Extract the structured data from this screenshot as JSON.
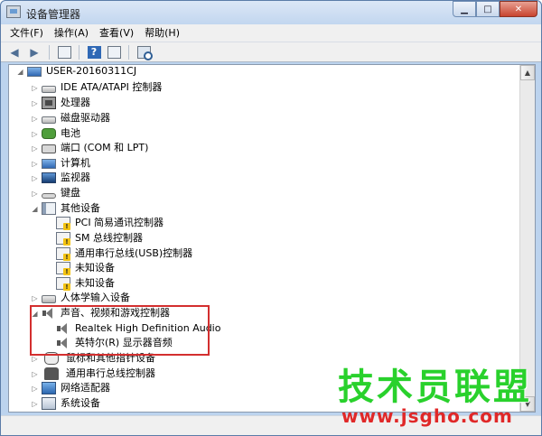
{
  "window": {
    "title": "设备管理器"
  },
  "window_buttons": {
    "minimize": "▁",
    "maximize": "□",
    "close": "✕"
  },
  "menu": {
    "items": [
      "文件(F)",
      "操作(A)",
      "查看(V)",
      "帮助(H)"
    ]
  },
  "toolbar": {
    "icons": [
      "back-arrow-icon",
      "forward-arrow-icon",
      "properties-icon",
      "help-icon",
      "console-tree-icon",
      "scan-hardware-icon"
    ]
  },
  "scrollbar": {
    "up": "▲",
    "down": "▼"
  },
  "tree": {
    "root": {
      "label": "USER-20160311CJ"
    },
    "expander_collapsed": "▷",
    "expander_expanded": "◢",
    "nodes": [
      {
        "label": "IDE ATA/ATAPI 控制器"
      },
      {
        "label": "处理器"
      },
      {
        "label": "磁盘驱动器"
      },
      {
        "label": "电池"
      },
      {
        "label": "端口 (COM 和 LPT)"
      },
      {
        "label": "计算机"
      },
      {
        "label": "监视器"
      },
      {
        "label": "键盘"
      },
      {
        "label": "其他设备"
      },
      {
        "label": "PCI 简易通讯控制器"
      },
      {
        "label": "SM 总线控制器"
      },
      {
        "label": "通用串行总线(USB)控制器"
      },
      {
        "label": "未知设备"
      },
      {
        "label": "未知设备"
      },
      {
        "label": "人体学输入设备"
      },
      {
        "label": "声音、视频和游戏控制器"
      },
      {
        "label": "Realtek High Definition Audio"
      },
      {
        "label": "英特尔(R) 显示器音频"
      },
      {
        "label": "鼠标和其他指针设备"
      },
      {
        "label": "通用串行总线控制器"
      },
      {
        "label": "网络适配器"
      },
      {
        "label": "系统设备"
      }
    ]
  },
  "watermark": {
    "title": "技术员联盟",
    "url": "www.jsgho.com"
  },
  "colors": {
    "highlight": "#d32f2f",
    "watermark_green": "#29d12c",
    "watermark_red": "#e02828"
  }
}
